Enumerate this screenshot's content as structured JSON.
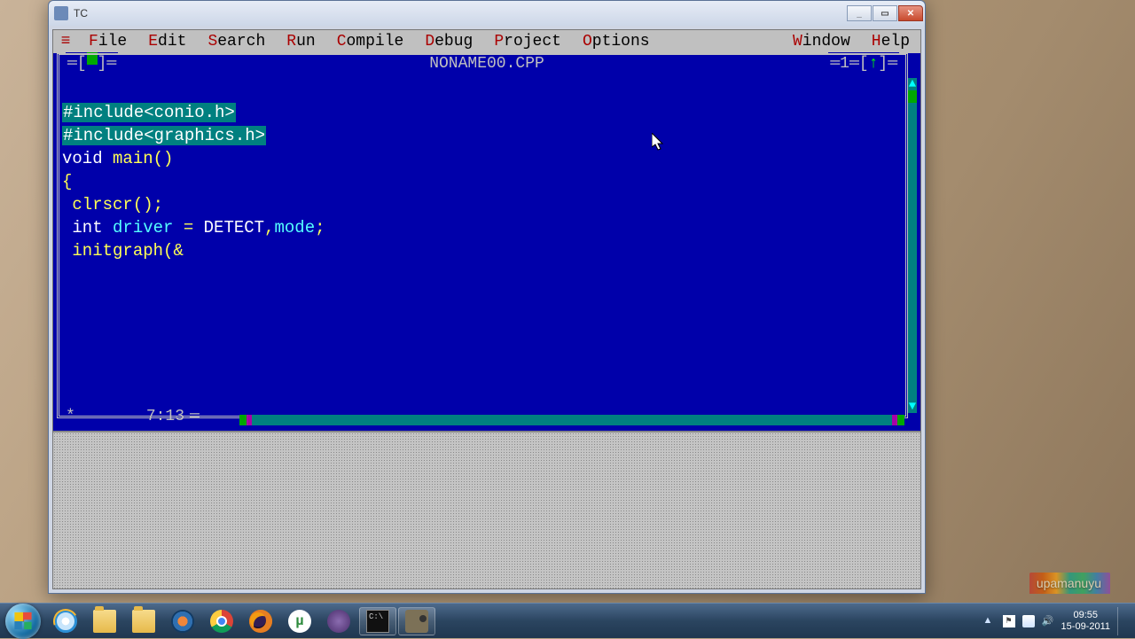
{
  "window": {
    "title": "TC",
    "buttons": {
      "min": "_",
      "max": "▭",
      "close": "✕"
    }
  },
  "tc": {
    "menus": [
      "File",
      "Edit",
      "Search",
      "Run",
      "Compile",
      "Debug",
      "Project",
      "Options",
      "Window",
      "Help"
    ],
    "hotkeys": [
      "F",
      "E",
      "S",
      "R",
      "C",
      "D",
      "P",
      "O",
      "W",
      "H"
    ],
    "filename": "NONAME00.CPP",
    "line_indicator": "1",
    "arrow": "↑",
    "cursor_pos": "7:13",
    "code": {
      "l1": "#include<conio.h>",
      "l2": "#include<graphics.h>",
      "l3a": "void ",
      "l3b": "main",
      "l3c": "()",
      "l4": "{",
      "l5a": " clrscr",
      "l5b": "();",
      "l6a": " int ",
      "l6b": "driver",
      "l6c": " = ",
      "l6d": "DETECT",
      "l6e": ",",
      "l6f": "mode",
      "l6g": ";",
      "l7a": " initgraph",
      "l7b": "(",
      "l7c": "&"
    }
  },
  "taskbar": {
    "icons": [
      "ie",
      "folder",
      "folder",
      "wmp",
      "chrome",
      "ff",
      "ut",
      "bt",
      "cmd",
      "cam"
    ],
    "clock_time": "09:55",
    "clock_date": "15-09-2011"
  },
  "overlay": "upamanuyu"
}
